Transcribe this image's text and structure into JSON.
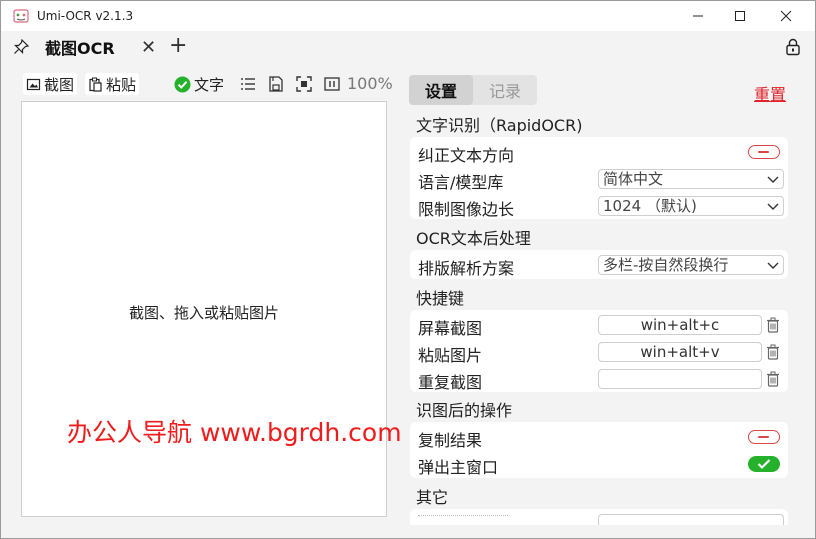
{
  "window": {
    "title": "Umi-OCR v2.1.3",
    "controls": {
      "minimize": "—",
      "maximize": "☐",
      "close": "✕"
    }
  },
  "tabbar": {
    "active_tab": "截图OCR",
    "close_symbol": "✕",
    "add_symbol": "+"
  },
  "left_toolbar": {
    "screenshot_label": "截图",
    "paste_label": "粘贴",
    "text_toggle_label": "文字",
    "zoom": "100%"
  },
  "canvas": {
    "hint": "截图、拖入或粘贴图片"
  },
  "right_panel": {
    "tabs": [
      {
        "label": "设置",
        "active": true
      },
      {
        "label": "记录",
        "active": false
      }
    ],
    "reset_label": "重置",
    "sections": {
      "ocr": {
        "title": "文字识别（RapidOCR)",
        "rows": {
          "orientation": {
            "label": "纠正文本方向",
            "enabled": false
          },
          "language": {
            "label": "语言/模型库",
            "value": "简体中文"
          },
          "limit": {
            "label": "限制图像边长",
            "value": "1024 （默认)"
          }
        }
      },
      "post": {
        "title": "OCR文本后处理",
        "rows": {
          "layout": {
            "label": "排版解析方案",
            "value": "多栏-按自然段换行"
          }
        }
      },
      "hotkeys": {
        "title": "快捷键",
        "rows": {
          "screenshot": {
            "label": "屏幕截图",
            "value": "win+alt+c"
          },
          "paste": {
            "label": "粘贴图片",
            "value": "win+alt+v"
          },
          "repeat": {
            "label": "重复截图",
            "value": ""
          }
        }
      },
      "after": {
        "title": "识图后的操作",
        "rows": {
          "copy": {
            "label": "复制结果",
            "enabled": false
          },
          "popup": {
            "label": "弹出主窗口",
            "enabled": true
          }
        }
      },
      "other": {
        "title": "其它"
      }
    }
  },
  "watermark": "办公人导航 www.bgrdh.com",
  "colors": {
    "accent_red": "#e2232a",
    "switch_on": "#26b12d",
    "switch_off": "#d84848",
    "watermark": "#ee1c1c"
  }
}
